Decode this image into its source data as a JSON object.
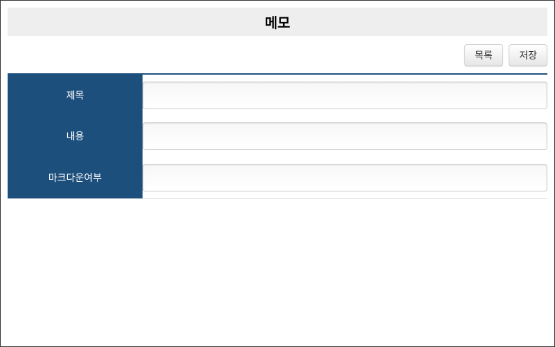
{
  "header": {
    "title": "메모"
  },
  "actions": {
    "list_label": "목록",
    "save_label": "저장"
  },
  "form": {
    "rows": [
      {
        "label": "제목",
        "value": ""
      },
      {
        "label": "내용",
        "value": ""
      },
      {
        "label": "마크다운여부",
        "value": ""
      }
    ]
  }
}
